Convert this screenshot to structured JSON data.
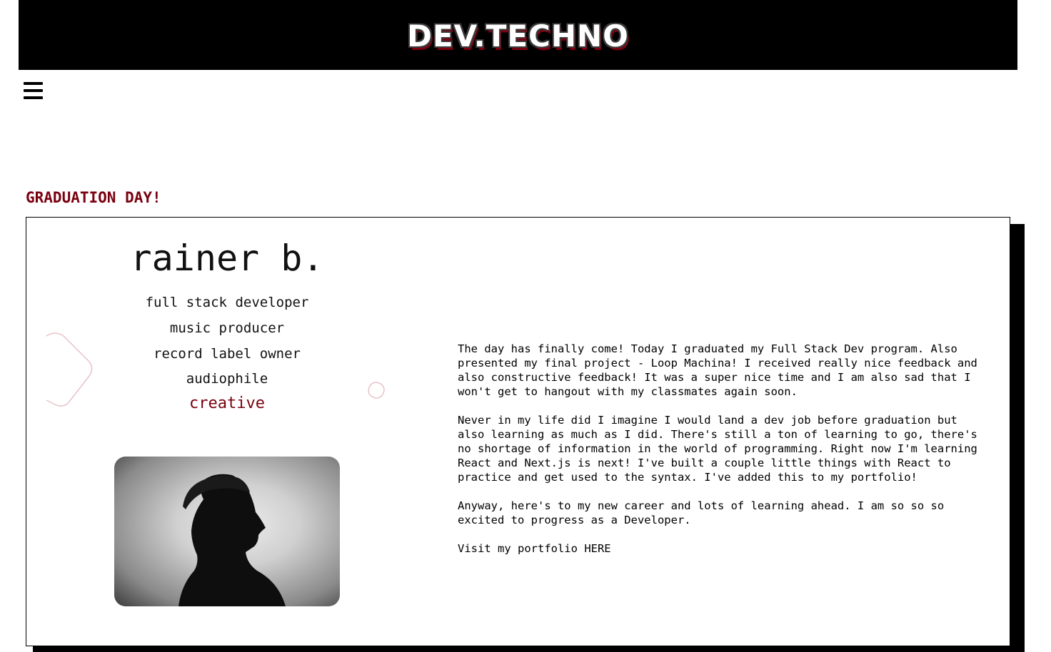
{
  "site": {
    "title": "DEV.TECHNO"
  },
  "nav": {
    "menu_icon": "hamburger-menu-icon"
  },
  "post": {
    "title": "GRADUATION DAY!",
    "paragraphs": [
      "The day has finally come! Today I graduated my Full Stack Dev program. Also presented my final project - Loop Machina! I received really nice feedback and also constructive feedback! It was a super nice time and I am also sad that I won't get to hangout with my classmates again soon.",
      "Never in my life did I imagine I would land a dev job before graduation but also learning as much as I did. There's still a ton of learning to go, there's no shortage of information in the world of programming. Right now I'm learning React and Next.js is next! I've built a couple little things with React to practice and get used to the syntax. I've added this to my portfolio!",
      "Anyway, here's to my new career and lots of learning ahead. I am so so so excited to progress as a Developer."
    ],
    "portfolio_prefix": "Visit my portfolio ",
    "portfolio_link": "HERE"
  },
  "profile": {
    "name": "rainer b.",
    "roles": [
      "full stack developer",
      "music producer",
      "record label owner",
      "audiophile",
      "creative"
    ],
    "photo_icon": "profile-photo-silhouette"
  },
  "colors": {
    "header_bg": "#000000",
    "accent": "#7a0010",
    "text": "#000000",
    "deco_stroke": "#e7c3c9"
  }
}
